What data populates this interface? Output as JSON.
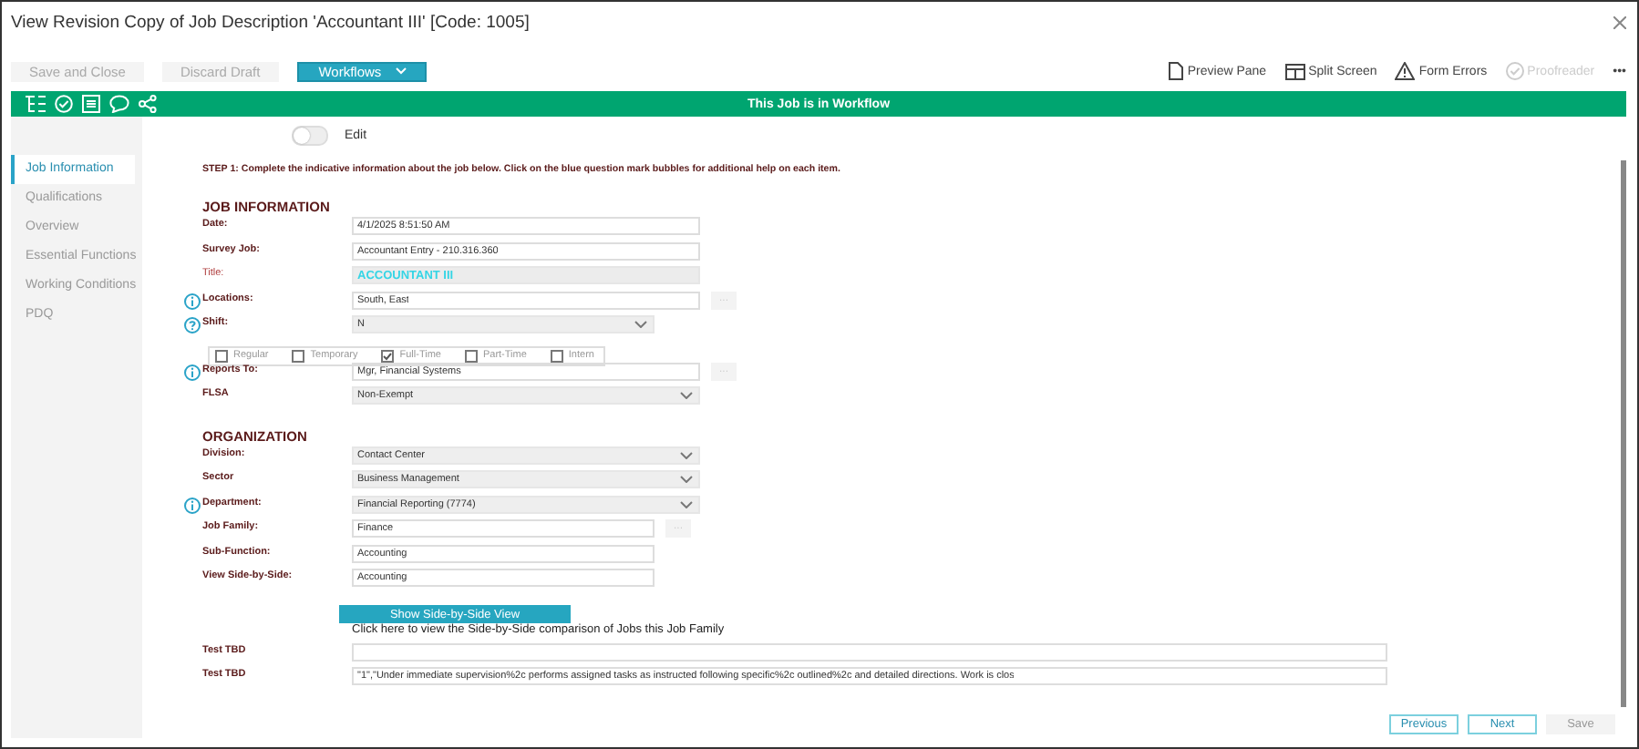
{
  "window": {
    "title": "View Revision Copy of Job Description 'Accountant III' [Code: 1005]"
  },
  "toolbar_left": [
    {
      "label": "Save and Close",
      "kind": "plain",
      "disabled": true
    },
    {
      "label": "Discard Draft",
      "kind": "plain",
      "disabled": true
    },
    {
      "label": "Workflows",
      "kind": "dropdown",
      "disabled": false
    }
  ],
  "toolbar_right": [
    {
      "label": "Preview Pane",
      "disabled": false
    },
    {
      "label": "Split Screen",
      "disabled": false
    },
    {
      "label": "Form Errors",
      "disabled": false
    },
    {
      "label": "Proofreader",
      "disabled": true
    }
  ],
  "more": "•••",
  "banner": "This Job is in Workflow",
  "sidebar": {
    "items": [
      {
        "label": "Job Information",
        "selected": true
      },
      {
        "label": "Qualifications",
        "selected": false
      },
      {
        "label": "Overview",
        "selected": false
      },
      {
        "label": "Essential Functions",
        "selected": false
      },
      {
        "label": "Working Conditions",
        "selected": false
      },
      {
        "label": "PDQ",
        "selected": false
      }
    ]
  },
  "edit_toggle": {
    "label": "Edit",
    "on": false
  },
  "instructions": "STEP 1:  Complete the indicative information about the job below.  Click on the blue question mark bubbles for additional help on each item.",
  "rows": [
    {
      "kind": "heading",
      "label": "JOB INFORMATION"
    },
    {
      "kind": "text",
      "label": "Date:",
      "value": "4/1/2025 8:51:50 AM"
    },
    {
      "kind": "text",
      "label": "Survey Job:",
      "value": "Accountant Entry - 210.316.360"
    },
    {
      "kind": "readonly",
      "label": "Title:",
      "value": "ACCOUNTANT III"
    },
    {
      "kind": "text",
      "label": "Locations:",
      "value": "South, East",
      "bubble": true,
      "lookup": "···"
    },
    {
      "kind": "select",
      "label": "Shift:",
      "value": "N",
      "short": true,
      "bubble": true
    },
    {
      "kind": "checks",
      "options": [
        {
          "label": "Regular",
          "checked": false
        },
        {
          "label": "Temporary",
          "checked": false
        },
        {
          "label": "Full-Time",
          "checked": true
        },
        {
          "label": "Part-Time",
          "checked": false
        },
        {
          "label": "Intern",
          "checked": false
        }
      ]
    },
    {
      "kind": "text",
      "label": "Reports To:",
      "value": "Mgr, Financial Systems",
      "bubble": true,
      "lookup": "···"
    },
    {
      "kind": "select",
      "label": "FLSA",
      "value": "Non-Exempt"
    },
    {
      "kind": "heading",
      "label": "ORGANIZATION"
    },
    {
      "kind": "select",
      "label": "Division:",
      "value": "Contact Center"
    },
    {
      "kind": "select",
      "label": "Sector",
      "value": "Business Management"
    },
    {
      "kind": "select",
      "label": "Department:",
      "value": "Financial Reporting (7774)",
      "bubble": true
    },
    {
      "kind": "text",
      "label": "Job Family:",
      "value": "Finance",
      "short": true,
      "lookup": "···"
    },
    {
      "kind": "text",
      "label": "Sub-Function:",
      "value": "Accounting",
      "short": true
    },
    {
      "kind": "text",
      "label": "View Side-by-Side:",
      "value": "Accounting",
      "short": true
    },
    {
      "kind": "button",
      "label": "Show Side-by-Side View"
    },
    {
      "kind": "note",
      "label": "Click here to view the Side-by-Side comparison of Jobs this Job Family"
    },
    {
      "kind": "text",
      "label": "Test TBD",
      "wide": true
    },
    {
      "kind": "text",
      "label": "Test TBD",
      "value": "\"1\",\"Under immediate supervision%2c performs assigned tasks as instructed following specific%2c outlined%2c and detailed directions.  Work is clos",
      "wide": true
    }
  ],
  "footer": [
    {
      "label": "Previous",
      "disabled": false
    },
    {
      "label": "Next",
      "disabled": false
    },
    {
      "label": "Save",
      "disabled": true
    }
  ]
}
